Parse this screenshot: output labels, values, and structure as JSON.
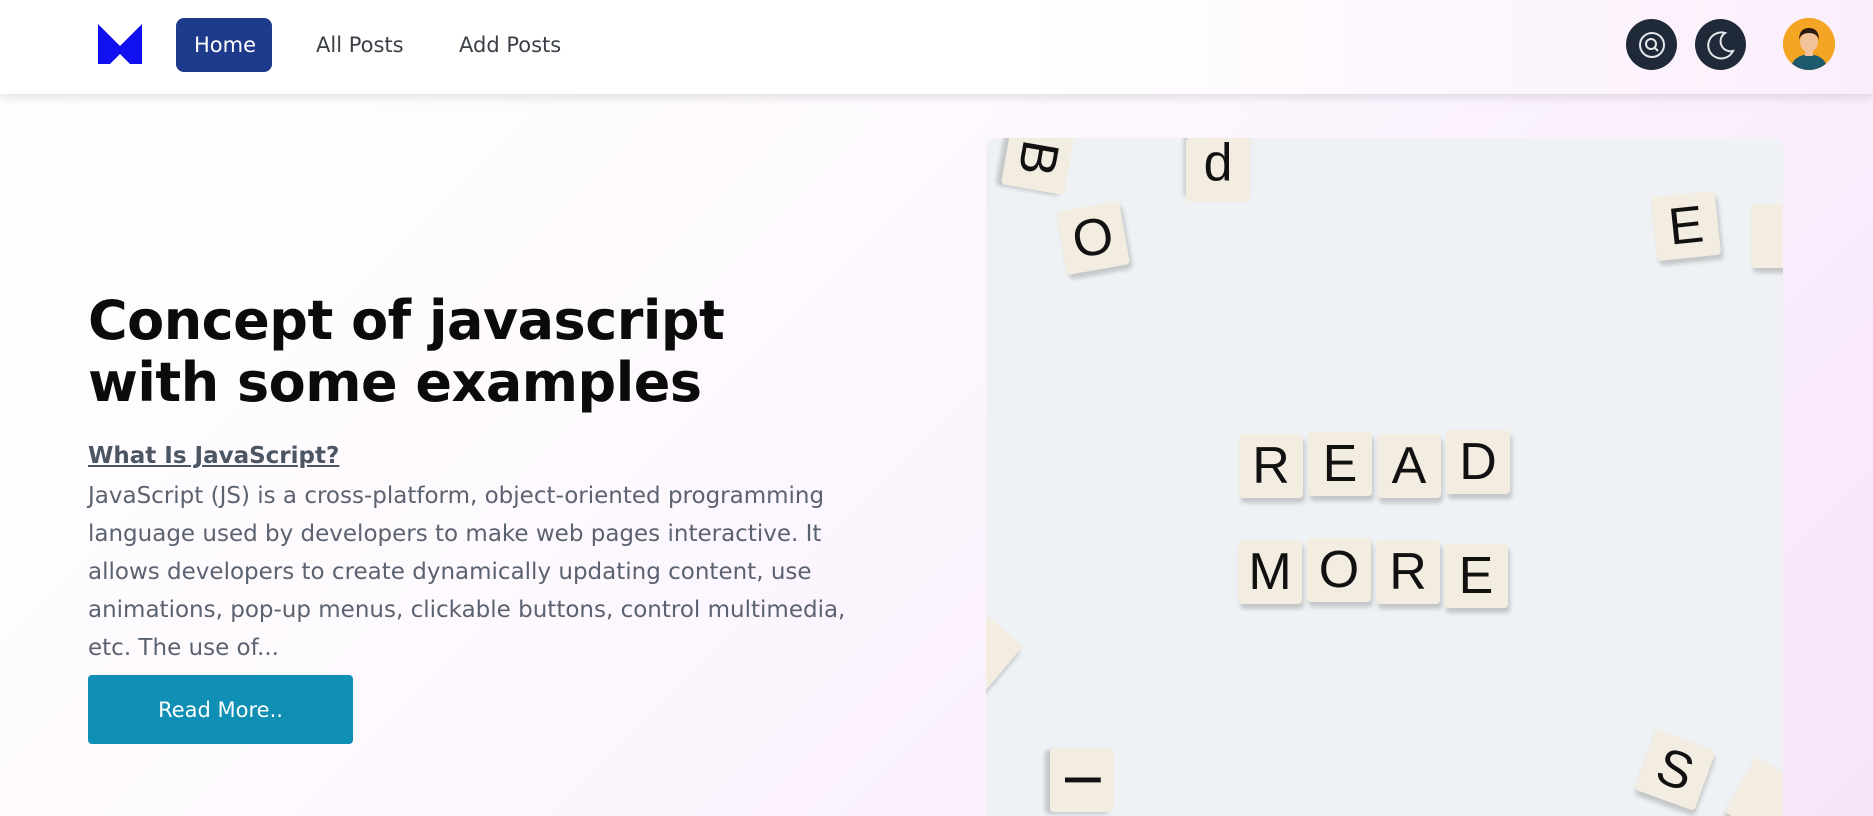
{
  "nav": {
    "links": [
      {
        "label": "Home",
        "active": true
      },
      {
        "label": "All Posts",
        "active": false
      },
      {
        "label": "Add Posts",
        "active": false
      }
    ],
    "icons": [
      "logo-m-icon",
      "search-icon",
      "moon-icon",
      "user-avatar"
    ],
    "accent": "#1e3a8a"
  },
  "hero": {
    "title": "Concept of javascript with some examples",
    "subheading": "What Is JavaScript?",
    "excerpt": "JavaScript (JS) is a cross-platform, object-oriented programming language used by developers to make web pages interactive. It allows developers to create dynamically updating content, use animations, pop-up menus, clickable buttons, control multimedia, etc. The use of...",
    "button_label": "Read More..",
    "button_color": "#0e8fb3"
  },
  "image": {
    "tiles_word1": [
      "R",
      "E",
      "A",
      "D"
    ],
    "tiles_word2": [
      "M",
      "O",
      "R",
      "E"
    ],
    "scattered": [
      "B",
      "p",
      "O",
      "E",
      "I",
      "S"
    ]
  }
}
